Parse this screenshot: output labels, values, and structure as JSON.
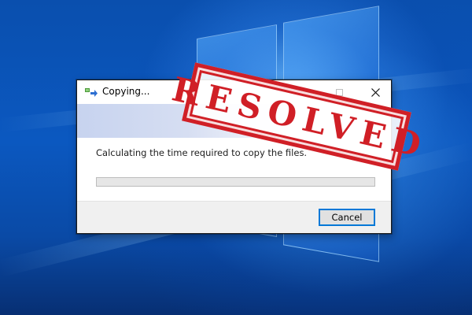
{
  "dialog": {
    "title": "Copying...",
    "message": "Calculating the time required to copy the files.",
    "progress_percent": 0,
    "cancel_label": "Cancel",
    "maximize_icon": "maximize-icon",
    "close_glyph": "✕",
    "title_icon": "copy-files-icon"
  },
  "stamp": {
    "text": "RESOLVED",
    "color": "#d01f26"
  },
  "colors": {
    "accent": "#0078d7",
    "progress_fill": "#06b025"
  }
}
